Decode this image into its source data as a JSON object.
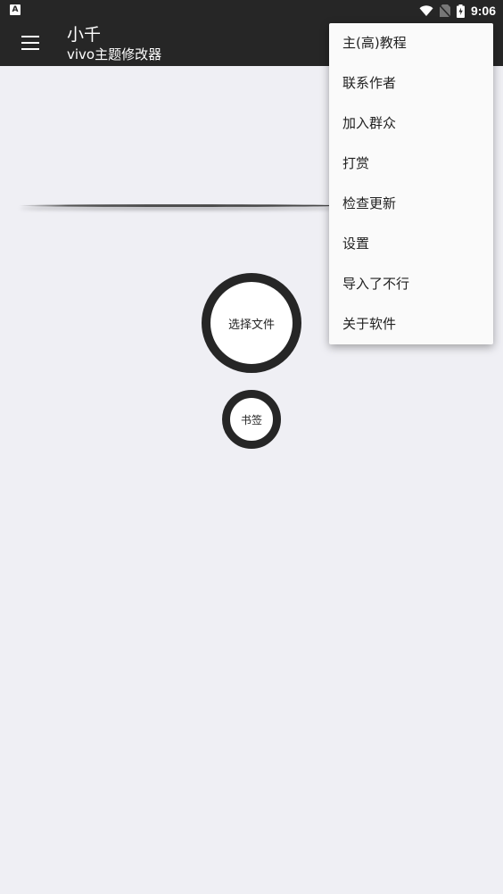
{
  "status_bar": {
    "notification_icon": "A",
    "time": "9:06",
    "icons": [
      "wifi-icon",
      "no-sim-icon",
      "battery-charging-icon"
    ]
  },
  "app_bar": {
    "title": "小千",
    "subtitle": "vivo主题修改器",
    "menu_icon": "hamburger-menu-icon"
  },
  "main": {
    "select_file_label": "选择文件",
    "bookmark_label": "书签"
  },
  "overflow_menu": {
    "items": [
      {
        "label": "主(高)教程"
      },
      {
        "label": "联系作者"
      },
      {
        "label": "加入群众"
      },
      {
        "label": "打赏"
      },
      {
        "label": "检查更新"
      },
      {
        "label": "设置"
      },
      {
        "label": "导入了不行"
      },
      {
        "label": "关于软件"
      }
    ]
  },
  "colors": {
    "bar": "#262626",
    "background": "#efeff4",
    "menu_bg": "#fafafa"
  }
}
